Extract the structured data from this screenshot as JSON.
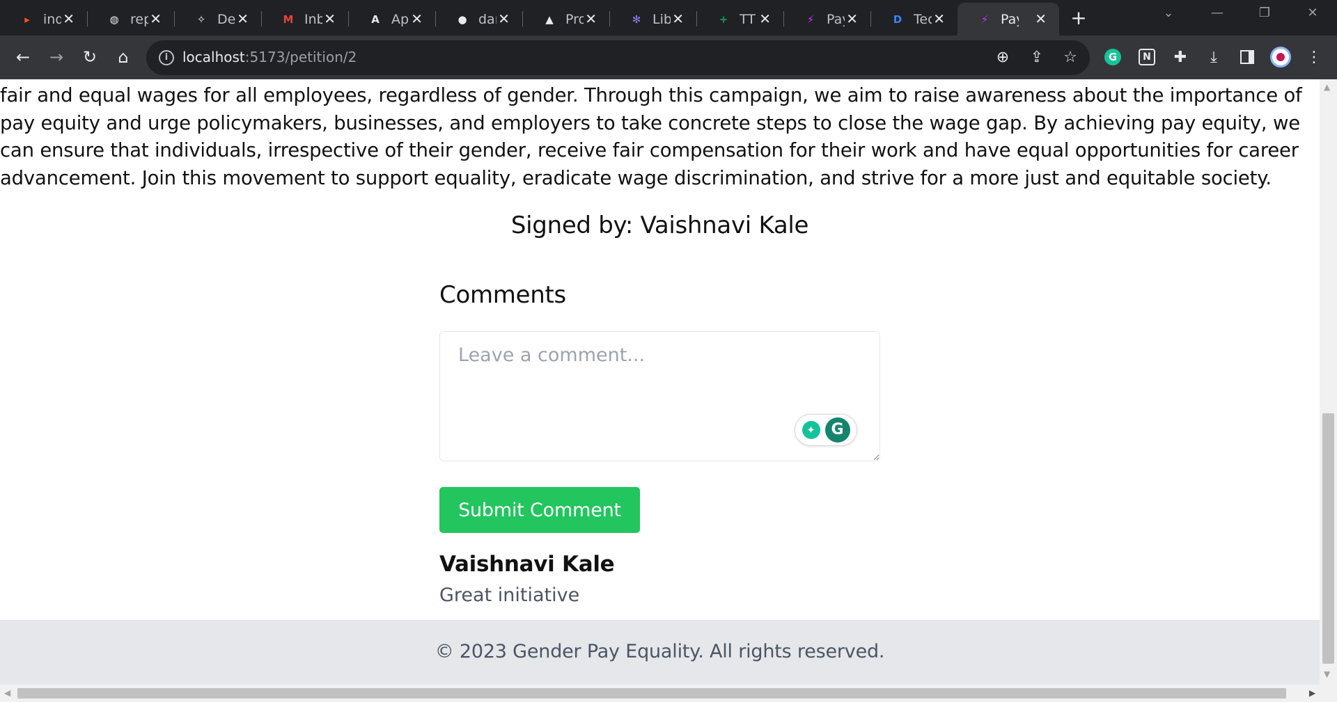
{
  "browser": {
    "tabs": [
      {
        "title": "ind",
        "icon": "relay-icon",
        "glyph": "▸",
        "color": "#ff4f1f"
      },
      {
        "title": "rep",
        "icon": "globe-icon",
        "glyph": "◍",
        "color": "#e8eaed"
      },
      {
        "title": "De",
        "icon": "devfolio-icon",
        "glyph": "✧",
        "color": "#e8eaed"
      },
      {
        "title": "Inb",
        "icon": "gmail-icon",
        "glyph": "M",
        "color": "#ea4335"
      },
      {
        "title": "Ap",
        "icon": "angular-icon",
        "glyph": "A",
        "color": "#e8eaed"
      },
      {
        "title": "dar",
        "icon": "github-icon",
        "glyph": "●",
        "color": "#e8eaed"
      },
      {
        "title": "Pro",
        "icon": "vercel-icon",
        "glyph": "▲",
        "color": "#e8eaed"
      },
      {
        "title": "Lib",
        "icon": "asterisk-icon",
        "glyph": "✻",
        "color": "#8b7cf6"
      },
      {
        "title": "TT",
        "icon": "sheets-icon",
        "glyph": "+",
        "color": "#0f9d58"
      },
      {
        "title": "Pay",
        "icon": "vite-icon",
        "glyph": "⚡",
        "color": "#bd34fe"
      },
      {
        "title": "Tec",
        "icon": "dev-icon",
        "glyph": "D",
        "color": "#3b82f6"
      },
      {
        "title": "Pay",
        "icon": "vite-icon",
        "glyph": "⚡",
        "color": "#bd34fe",
        "active": true
      }
    ],
    "address": {
      "host": "localhost",
      "rest": ":5173/petition/2"
    }
  },
  "petition": {
    "description": "fair and equal wages for all employees, regardless of gender. Through this campaign, we aim to raise awareness about the importance of pay equity and urge policymakers, businesses, and employers to take concrete steps to close the wage gap. By achieving pay equity, we can ensure that individuals, irrespective of their gender, receive fair compensation for their work and have equal opportunities for career advancement. Join this movement to support equality, eradicate wage discrimination, and strive for a more just and equitable society.",
    "signed_by": "Signed by: Vaishnavi Kale"
  },
  "comments": {
    "heading": "Comments",
    "placeholder": "Leave a comment...",
    "submit_label": "Submit Comment",
    "items": [
      {
        "author": "Vaishnavi Kale",
        "text": "Great initiative"
      }
    ]
  },
  "footer": {
    "text": "© 2023 Gender Pay Equality. All rights reserved."
  },
  "colors": {
    "accent": "#22c55e",
    "footer_bg": "#e5e7eb"
  }
}
